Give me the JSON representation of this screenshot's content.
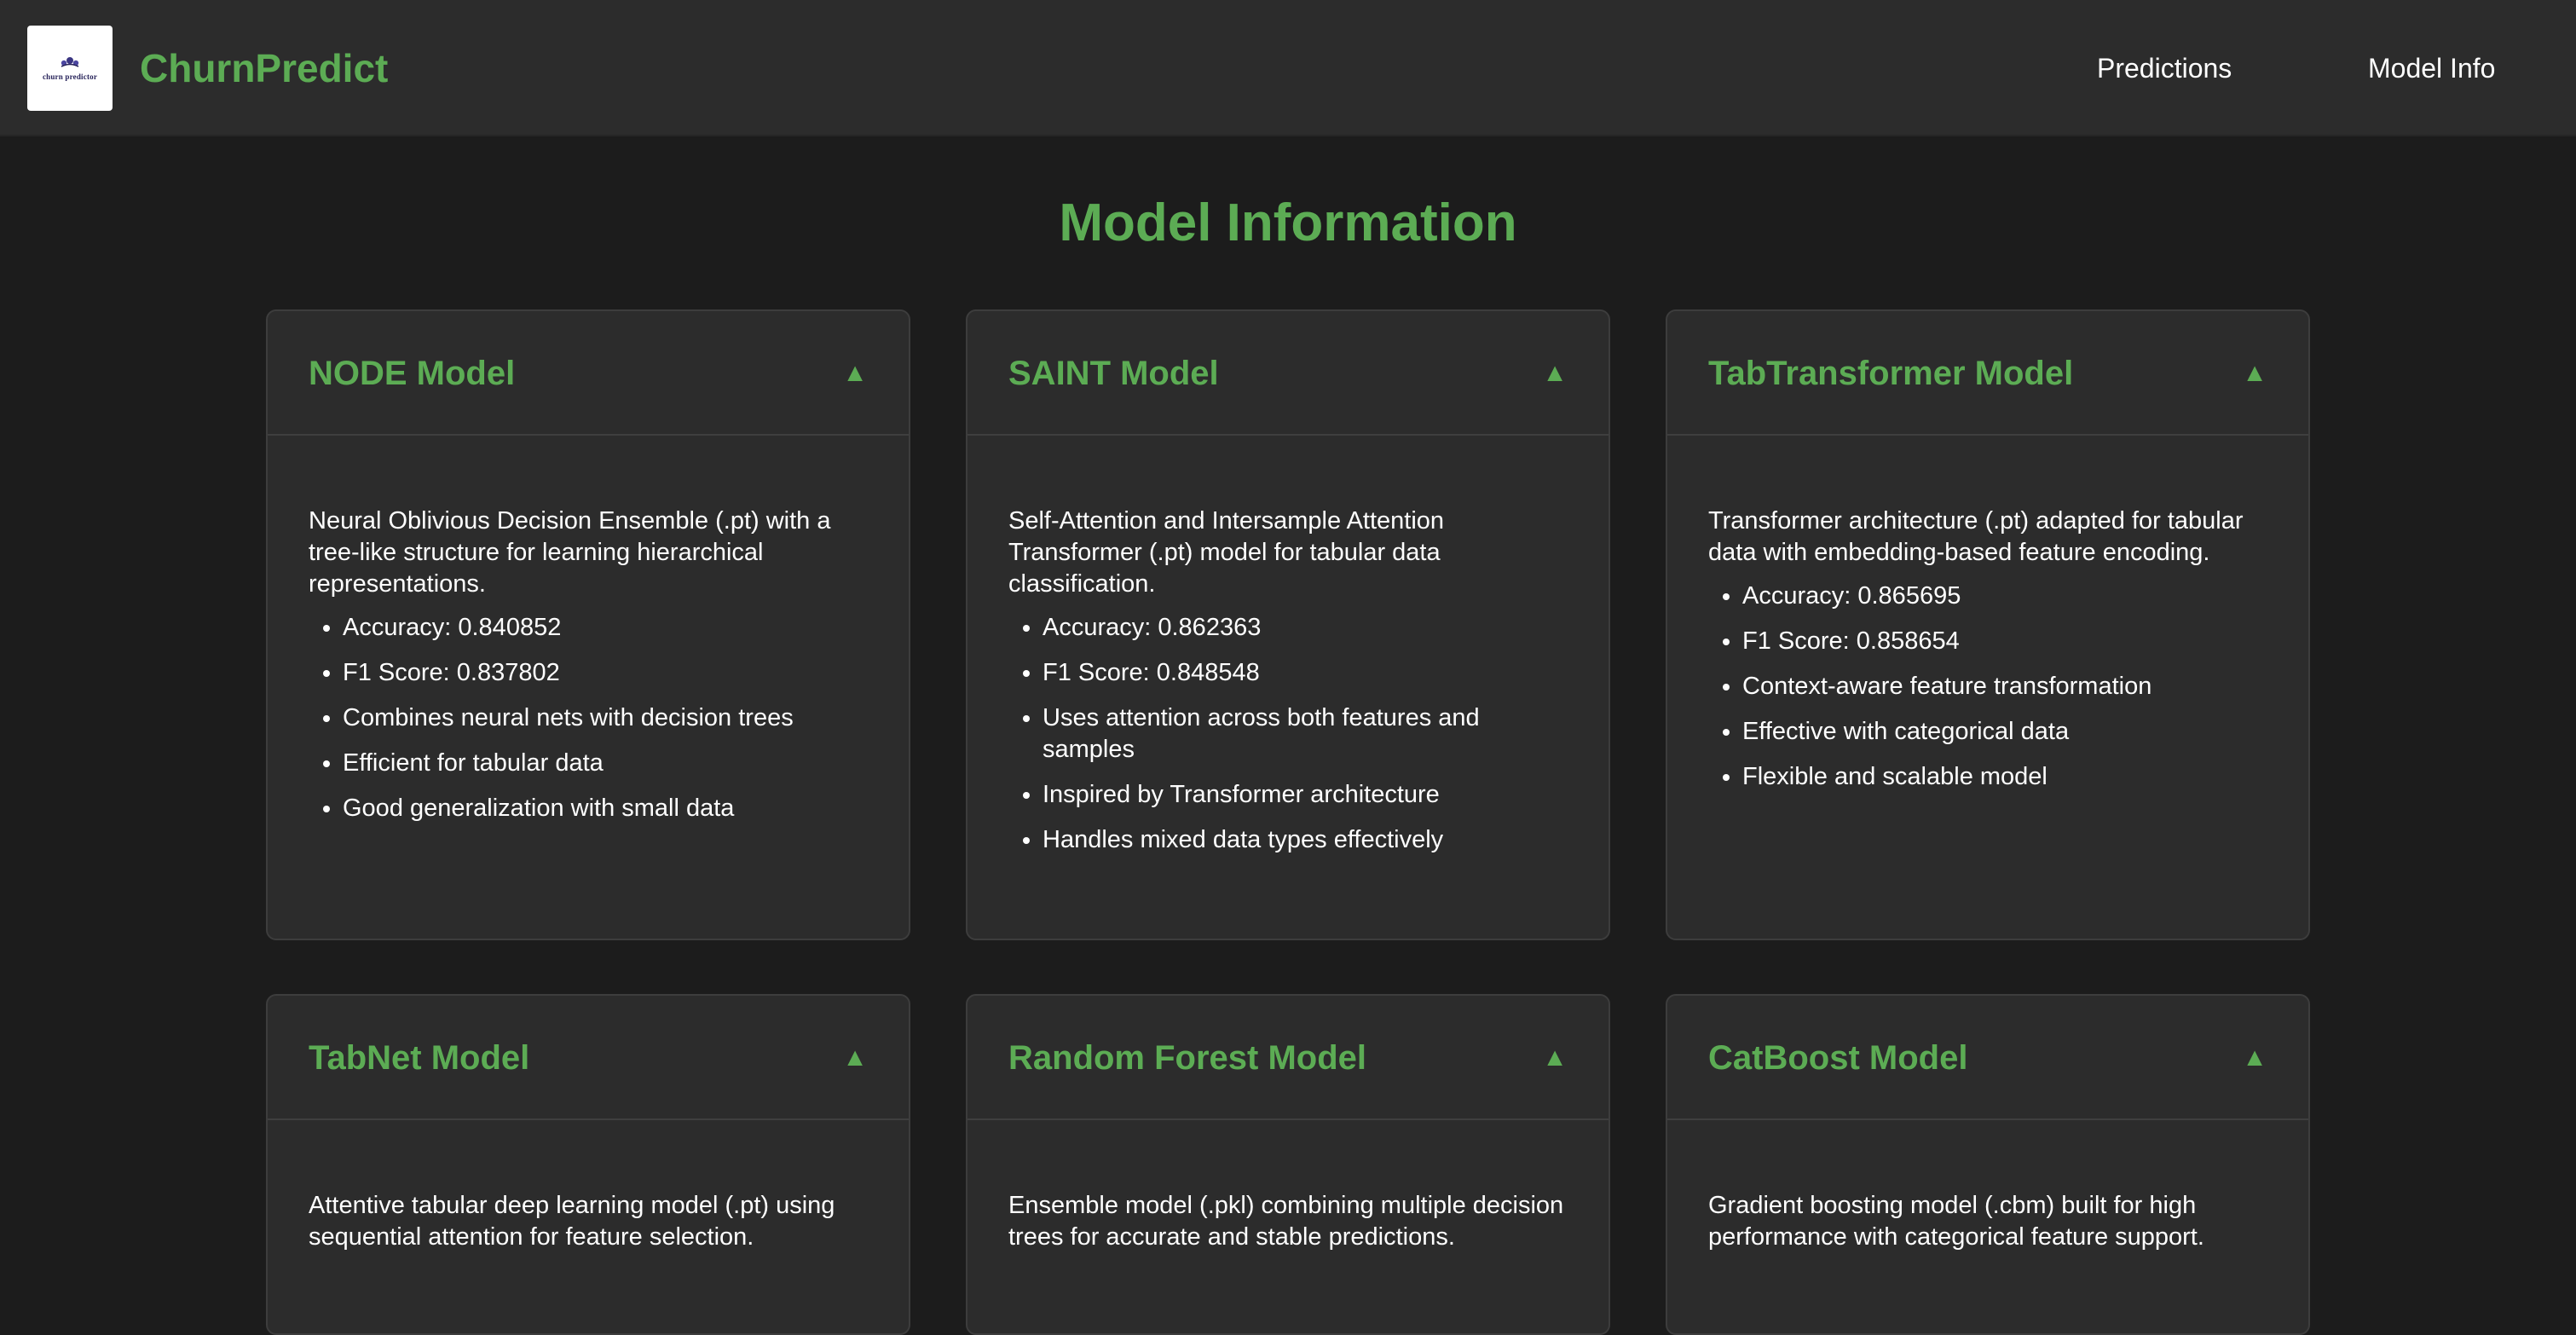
{
  "header": {
    "logo_text": "churn predictor",
    "brand": "ChurnPredict",
    "nav": [
      {
        "label": "Predictions"
      },
      {
        "label": "Model Info"
      }
    ]
  },
  "main": {
    "title": "Model Information",
    "toggle_symbol": "▲",
    "cards": [
      {
        "title": "NODE Model",
        "description": "Neural Oblivious Decision Ensemble (.pt) with a tree-like structure for learning hierarchical representations.",
        "items": [
          "Accuracy: 0.840852",
          "F1 Score: 0.837802",
          "Combines neural nets with decision trees",
          "Efficient for tabular data",
          "Good generalization with small data"
        ]
      },
      {
        "title": "SAINT Model",
        "description": "Self-Attention and Intersample Attention Transformer (.pt) model for tabular data classification.",
        "items": [
          "Accuracy: 0.862363",
          "F1 Score: 0.848548",
          "Uses attention across both features and samples",
          "Inspired by Transformer architecture",
          "Handles mixed data types effectively"
        ]
      },
      {
        "title": "TabTransformer Model",
        "description": "Transformer architecture (.pt) adapted for tabular data with embedding-based feature encoding.",
        "items": [
          "Accuracy: 0.865695",
          "F1 Score: 0.858654",
          "Context-aware feature transformation",
          "Effective with categorical data",
          "Flexible and scalable model"
        ]
      },
      {
        "title": "TabNet Model",
        "description": "Attentive tabular deep learning model (.pt) using sequential attention for feature selection.",
        "items": []
      },
      {
        "title": "Random Forest Model",
        "description": "Ensemble model (.pkl) combining multiple decision trees for accurate and stable predictions.",
        "items": []
      },
      {
        "title": "CatBoost Model",
        "description": "Gradient boosting model (.cbm) built for high performance with categorical feature support.",
        "items": []
      }
    ]
  },
  "colors": {
    "accent": "#5cac54",
    "background": "#1c1c1c",
    "surface": "#2c2c2c"
  }
}
